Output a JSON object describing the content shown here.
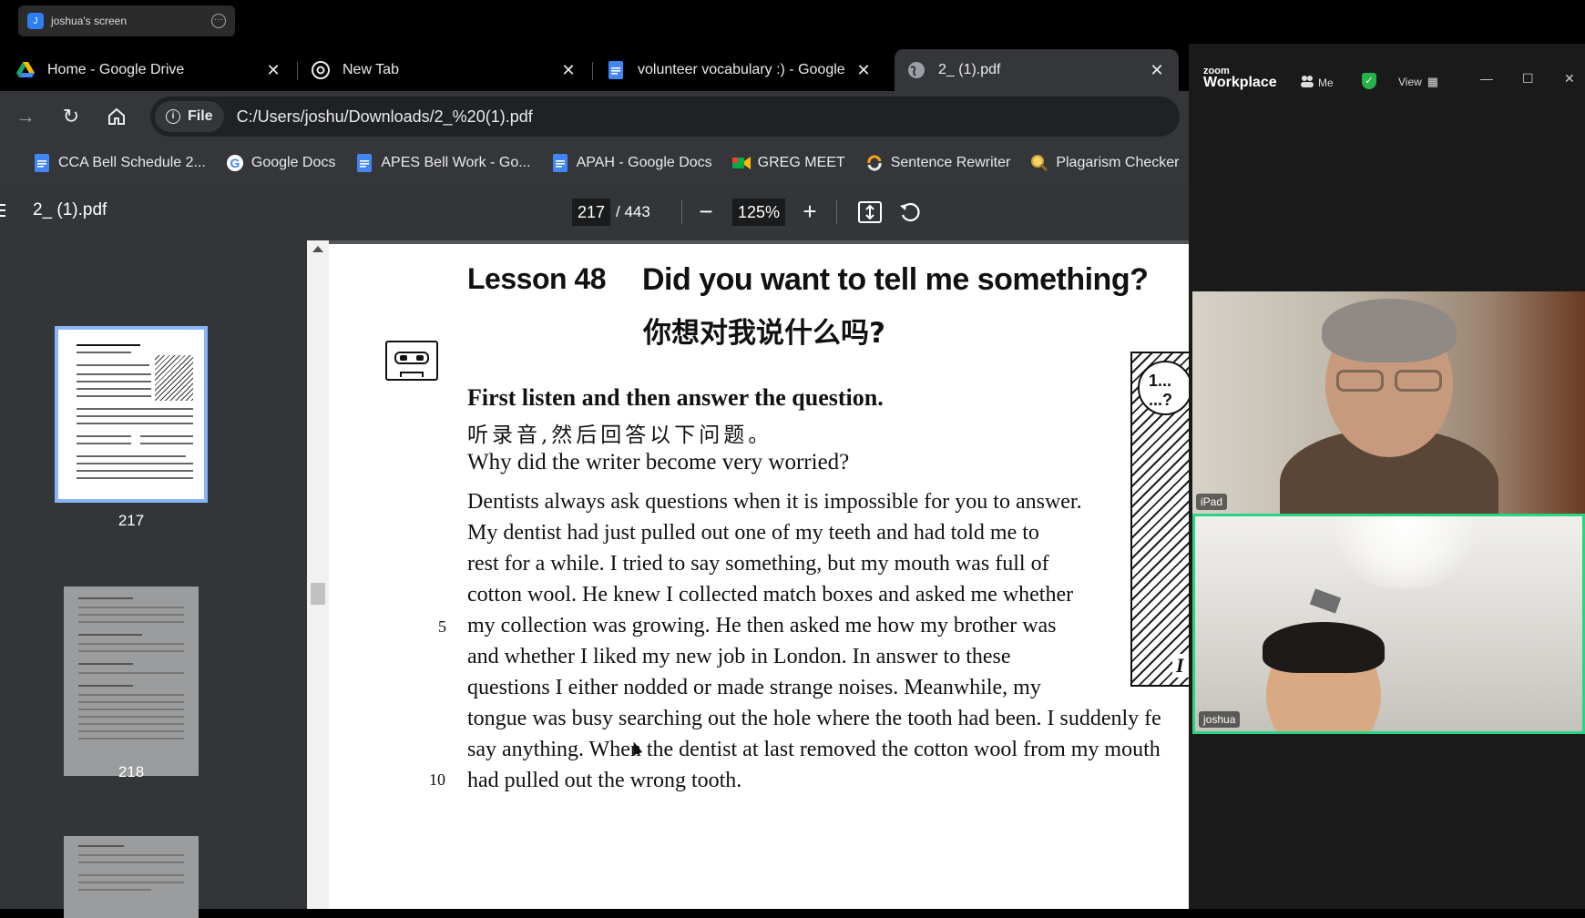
{
  "share_banner": {
    "avatar_letter": "J",
    "label": "joshua's screen"
  },
  "browser": {
    "tabs": [
      {
        "title": "Home - Google Drive",
        "icon": "google-drive-icon"
      },
      {
        "title": "New Tab",
        "icon": "chrome-icon"
      },
      {
        "title": "volunteer vocabulary :) - Google Docs",
        "icon": "google-docs-icon"
      },
      {
        "title": "2_ (1).pdf",
        "icon": "globe-icon",
        "active": true
      }
    ],
    "omnibox": {
      "scheme_label": "File",
      "url": "C:/Users/joshu/Downloads/2_%20(1).pdf"
    },
    "bookmarks": [
      {
        "label": "CCA Bell Schedule 2...",
        "icon": "google-docs-icon"
      },
      {
        "label": "Google Docs",
        "icon": "google-icon"
      },
      {
        "label": "APES Bell Work - Go...",
        "icon": "google-docs-icon"
      },
      {
        "label": "APAH - Google Docs",
        "icon": "google-docs-icon"
      },
      {
        "label": "GREG MEET",
        "icon": "google-meet-icon"
      },
      {
        "label": "Sentence Rewriter",
        "icon": "rewriter-icon"
      },
      {
        "label": "Plagarism Checker",
        "icon": "magnifier-icon"
      }
    ]
  },
  "pdf": {
    "file_name": "2_ (1).pdf",
    "current_page": "217",
    "total_pages": "/ 443",
    "zoom": "125%",
    "thumbnails": [
      {
        "page": "217"
      },
      {
        "page": "218"
      },
      {
        "page": ""
      }
    ],
    "content": {
      "lesson": "Lesson 48",
      "heading": "Did you want to tell me something?",
      "heading_zh": "你想对我说什么吗?",
      "instruction": "First listen and then answer the question.",
      "instruction_zh": "听录音,然后回答以下问题。",
      "question": "Why did the writer become very worried?",
      "paragraph_lines": [
        "Dentists always ask questions when it is impossible for you to answer.",
        "My dentist had just pulled out one of my teeth and had told me to",
        "rest for a while. I tried to say something, but my mouth was full of",
        "cotton wool. He knew I collected match boxes and asked me whether",
        "my collection was growing. He then asked me how my brother was",
        "and whether I liked my new job in London. In answer to these",
        "questions I either nodded or made strange noises. Meanwhile, my",
        "tongue was busy searching out  the hole where the tooth had been. I suddenly fe",
        "say anything. When the dentist at last removed the cotton wool from my mouth",
        "had pulled out the wrong tooth."
      ],
      "line_numbers": {
        "five": "5",
        "ten": "10"
      },
      "illustration_text": {
        "bubble": "1...\n...?",
        "corner": "I s"
      }
    }
  },
  "zoom": {
    "brand_small": "zoom",
    "brand_large": "Workplace",
    "participants_label": "Me",
    "view_label": "View",
    "videos": [
      {
        "label": "iPad"
      },
      {
        "label": "joshua"
      }
    ],
    "colors": {
      "active_speaker": "#2bd483",
      "shield": "#27b34a"
    }
  }
}
